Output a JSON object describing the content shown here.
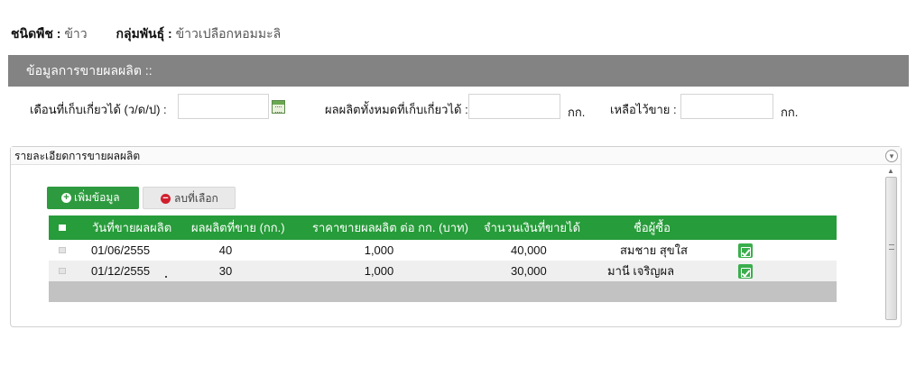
{
  "header": {
    "crop_label": "ชนิดพืช :",
    "crop_value": "ข้าว",
    "variety_label": "กลุ่มพันธุ์ :",
    "variety_value": "ข้าวเปลือกหอมมะลิ"
  },
  "section": {
    "title": "ข้อมูลการขายผลผลิต ::"
  },
  "fields": {
    "harvest_month_label": "เดือนที่เก็บเกี่ยวได้ (ว/ด/ป) :",
    "harvest_month_value": "",
    "total_yield_label": "ผลผลิตทั้งหมดที่เก็บเกี่ยวได้ :",
    "total_yield_value": "",
    "total_yield_unit": "กก.",
    "remaining_label": "เหลือไว้ขาย :",
    "remaining_value": "",
    "remaining_unit": "กก."
  },
  "panel": {
    "title": "รายละเอียดการขายผลผลิต"
  },
  "buttons": {
    "add_label": "เพิ่มข้อมูล",
    "delete_label": "ลบที่เลือก"
  },
  "table": {
    "columns": [
      "วันที่ขายผลผลิต",
      "ผลผลิตที่ขาย (กก.)",
      "ราคาขายผลผลิต ต่อ กก. (บาท)",
      "จำนวนเงินที่ขายได้",
      "ชื่อผู้ซื้อ"
    ],
    "rows": [
      {
        "date": "01/06/2555",
        "qty": "40",
        "price": "1,000",
        "amount": "40,000",
        "buyer": "สมชาย สุขใส"
      },
      {
        "date": "01/12/2555",
        "qty": "30",
        "price": "1,000",
        "amount": "30,000",
        "buyer": "มานี เจริญผล"
      }
    ]
  },
  "icons": {
    "calendar": "calendar-icon",
    "add": "plus-circle-icon",
    "delete": "minus-circle-icon",
    "edit": "edit-icon",
    "collapse": "chevron-down-icon"
  },
  "colors": {
    "section_bar": "#838383",
    "table_header": "#279c3a",
    "add_button": "#2e9a3f",
    "delete_icon": "#d11f2d",
    "footer_row": "#c2c2c2"
  }
}
